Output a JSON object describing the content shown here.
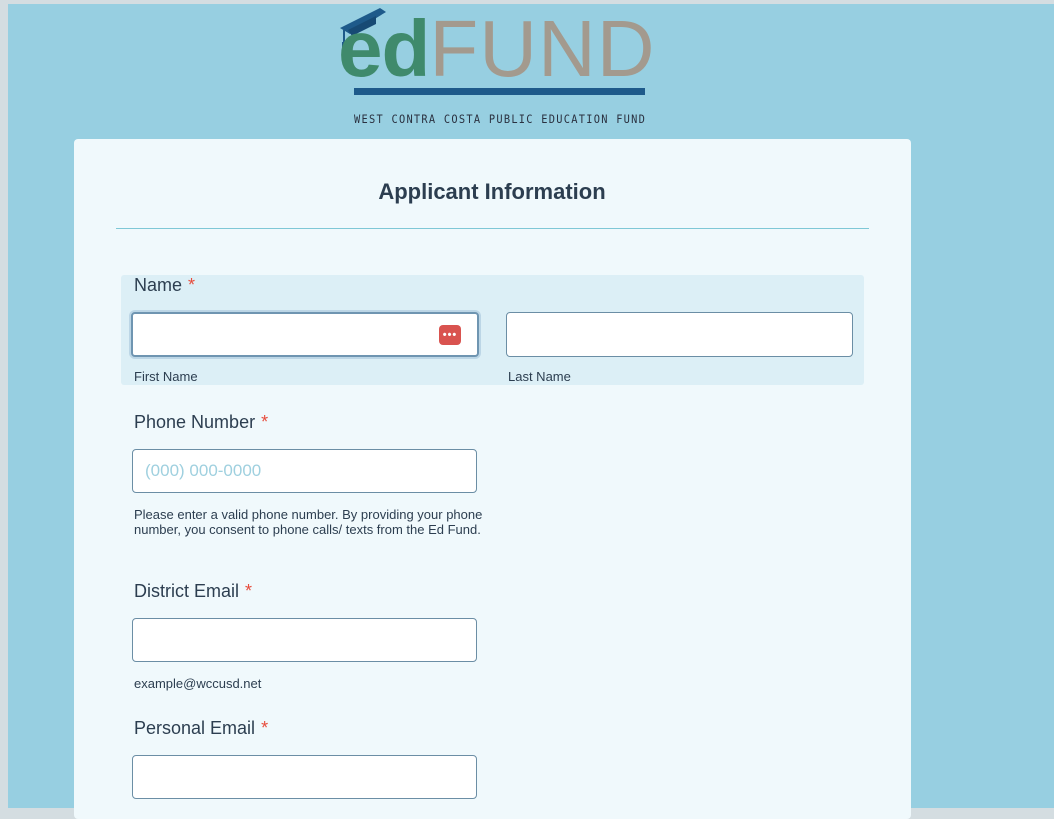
{
  "logo": {
    "word_part1": "ed",
    "word_part2": "FUND",
    "tagline": "WEST CONTRA COSTA PUBLIC EDUCATION FUND",
    "colors": {
      "ed": "#3f8a6c",
      "fund": "#a39a8e",
      "bar": "#1e5a8a",
      "cap": "#1e5a8a"
    }
  },
  "form": {
    "title": "Applicant Information",
    "required_marker": "*",
    "name": {
      "label": "Name",
      "first": {
        "value": "",
        "sublabel": "First Name",
        "icon": "password-manager-icon"
      },
      "last": {
        "value": "",
        "sublabel": "Last Name"
      }
    },
    "phone": {
      "label": "Phone Number",
      "placeholder": "(000) 000-0000",
      "value": "",
      "help": "Please enter a valid phone number. By providing your phone number, you consent to phone calls/ texts from the Ed Fund."
    },
    "district_email": {
      "label": "District Email",
      "value": "",
      "help": "example@wccusd.net"
    },
    "personal_email": {
      "label": "Personal Email",
      "value": ""
    }
  },
  "colors": {
    "page_bg": "#97cfe1",
    "card_bg": "#f0f9fc",
    "required": "#e74c3c",
    "text": "#2c3e50"
  }
}
